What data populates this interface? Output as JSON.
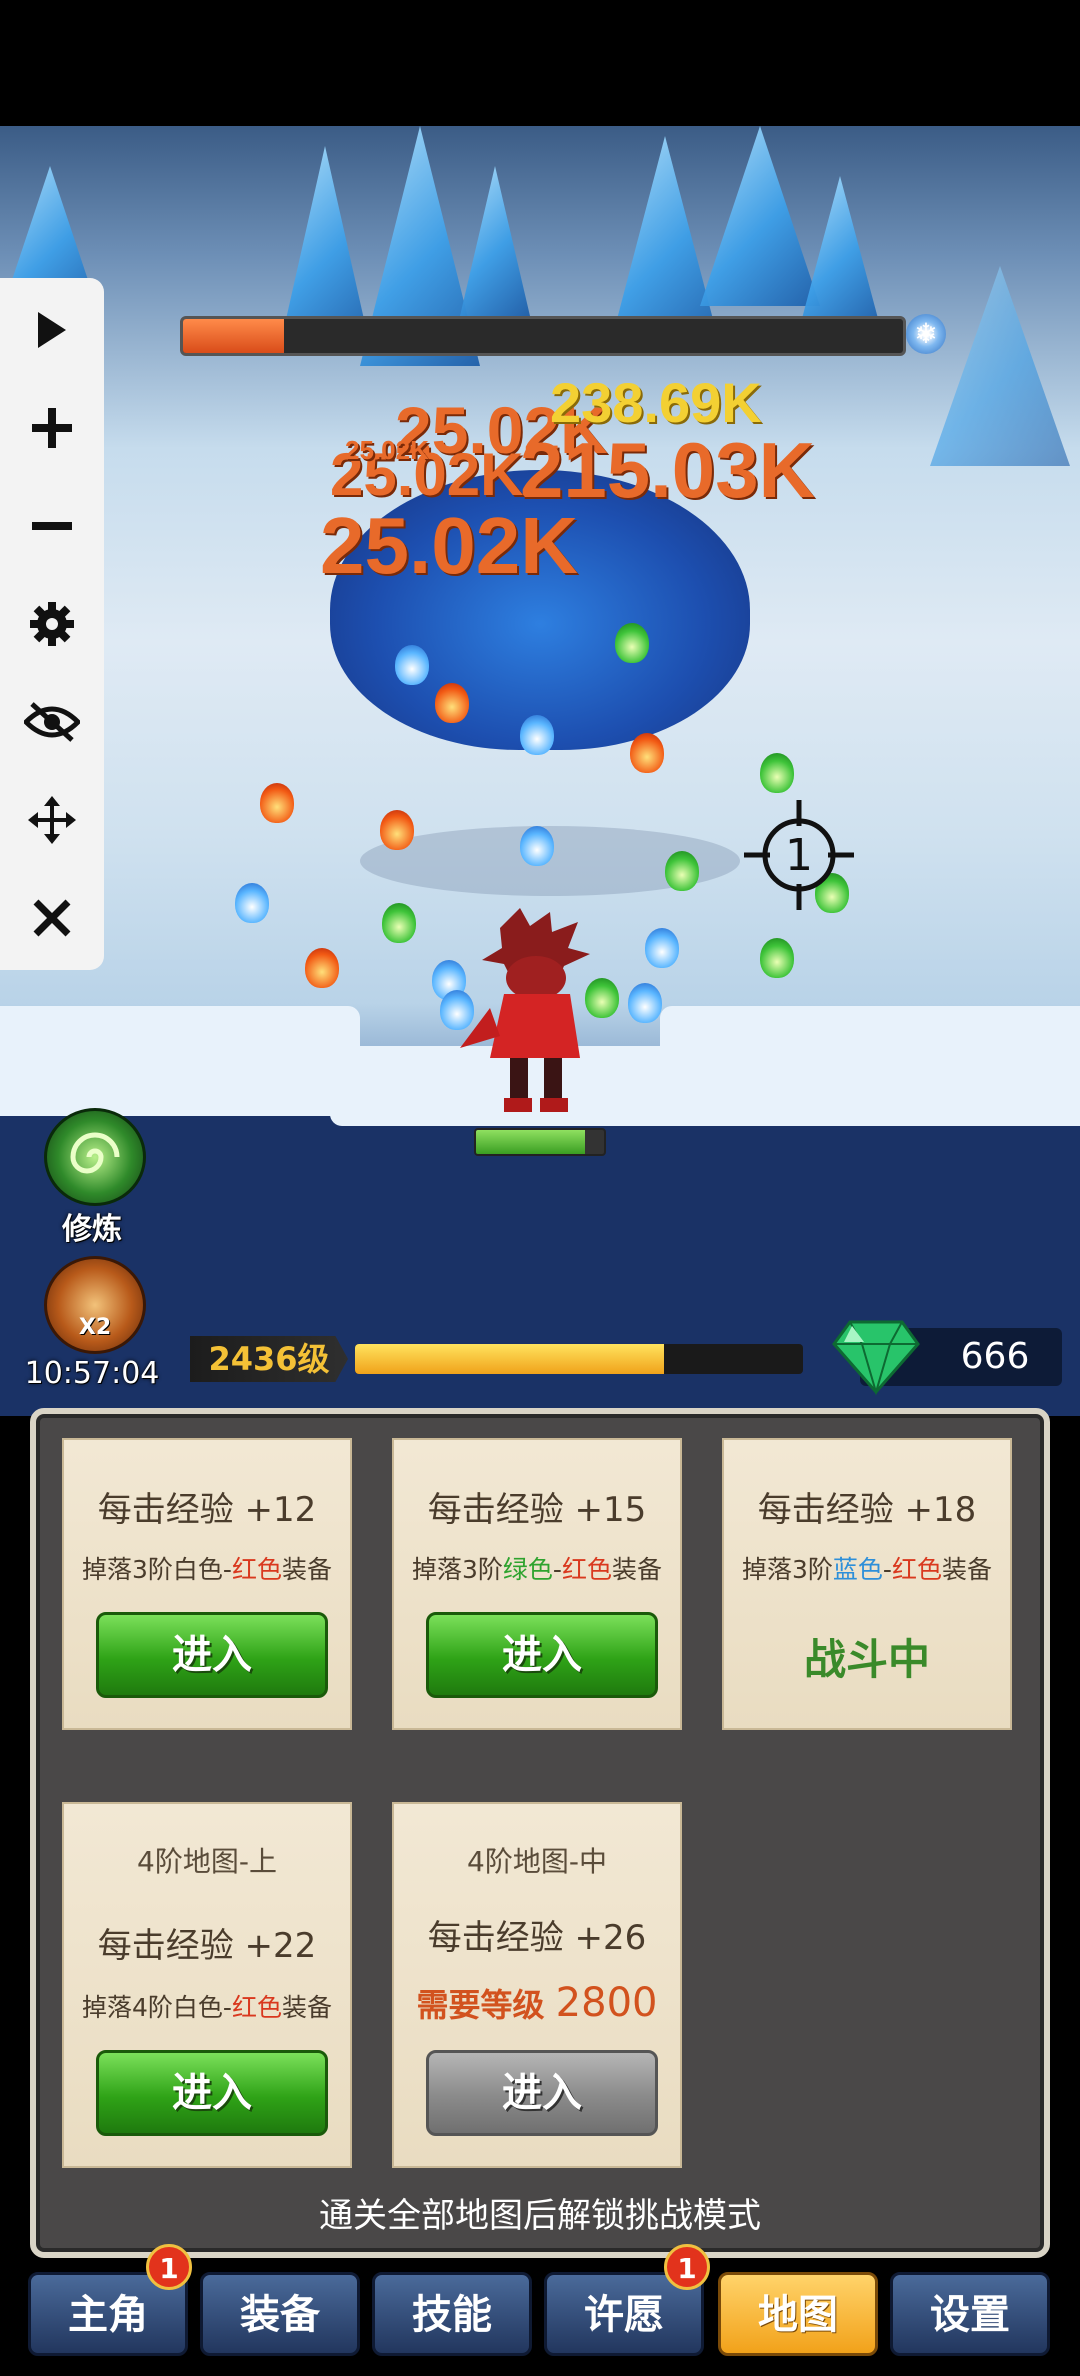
{
  "game": {
    "damage_numbers": [
      "25.02K",
      "238.69K",
      "215.03K",
      "25.02K",
      "25.02K",
      "25.02K"
    ],
    "crosshair_label": "1",
    "boss_hp_fraction": 0.14,
    "hero_hp_fraction": 0.85
  },
  "side": {
    "cultivate_label": "修炼",
    "x2_label": "X2",
    "timer": "10:57:04"
  },
  "player": {
    "level_label": "2436级",
    "exp_fraction": 0.69,
    "gems": "666"
  },
  "cards": [
    {
      "exp_prefix": "每击经验 +",
      "exp_value": "12",
      "drop_a": "掉落3阶白色-",
      "drop_b": "红色",
      "drop_c": "装备",
      "button": "进入"
    },
    {
      "exp_prefix": "每击经验 +",
      "exp_value": "15",
      "drop_a": "掉落3阶",
      "drop_b1": "绿色",
      "drop_mid": "-",
      "drop_b": "红色",
      "drop_c": "装备",
      "button": "进入"
    },
    {
      "exp_prefix": "每击经验 +",
      "exp_value": "18",
      "drop_a": "掉落3阶",
      "drop_b1": "蓝色",
      "drop_mid": "-",
      "drop_b": "红色",
      "drop_c": "装备",
      "status": "战斗中"
    },
    {
      "map_title": "4阶地图-上",
      "exp_prefix": "每击经验 +",
      "exp_value": "22",
      "drop_a": "掉落4阶白色-",
      "drop_b": "红色",
      "drop_c": "装备",
      "button": "进入"
    },
    {
      "map_title": "4阶地图-中",
      "exp_prefix": "每击经验 +",
      "exp_value": "26",
      "req_label": "需要等级",
      "req_value": "2800",
      "button": "进入"
    }
  ],
  "footer_note": "通关全部地图后解锁挑战模式",
  "nav": [
    {
      "label": "主角",
      "badge": "1"
    },
    {
      "label": "装备"
    },
    {
      "label": "技能"
    },
    {
      "label": "许愿",
      "badge": "1"
    },
    {
      "label": "地图",
      "active": true
    },
    {
      "label": "设置"
    }
  ],
  "colors": {
    "accent": "#f2a21a",
    "boss_hp": "#d94c19",
    "exp": "#f0a21a",
    "enter_button": "#2fa317"
  }
}
